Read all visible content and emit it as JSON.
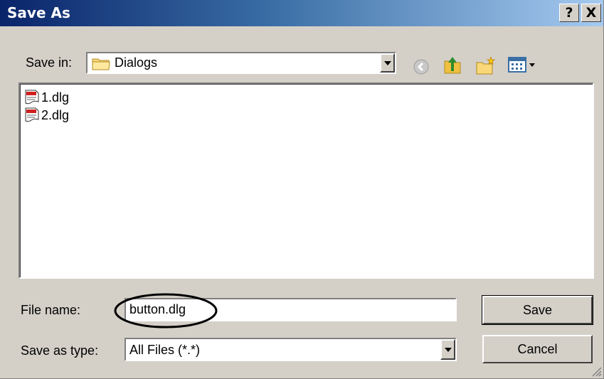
{
  "window": {
    "title": "Save As",
    "help_label": "?",
    "close_label": "X"
  },
  "location": {
    "label": "Save in:",
    "folder": "Dialogs",
    "folder_icon": "folder-icon"
  },
  "toolbar": {
    "icons": [
      "back-icon",
      "up-folder-icon",
      "new-folder-icon",
      "view-menu-icon"
    ]
  },
  "files": [
    {
      "name": "1.dlg",
      "icon": "document-icon"
    },
    {
      "name": "2.dlg",
      "icon": "document-icon"
    }
  ],
  "filename": {
    "label": "File name:",
    "value": "button.dlg"
  },
  "filetype": {
    "label": "Save as type:",
    "value": "All Files (*.*)"
  },
  "buttons": {
    "save": "Save",
    "cancel": "Cancel"
  },
  "colors": {
    "title_gradient_start": "#0a246a",
    "title_gradient_end": "#a6caf0",
    "face": "#d4d0c8"
  }
}
